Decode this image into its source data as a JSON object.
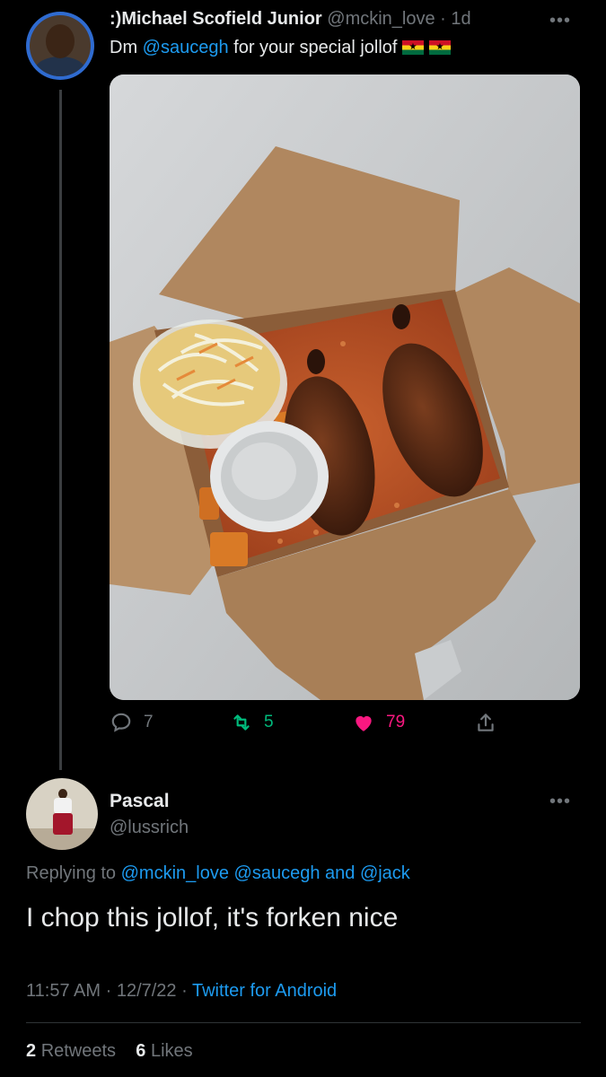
{
  "original_tweet": {
    "author_name": ":)Michael Scofield Junior",
    "handle": "@mckin_love",
    "separator": "·",
    "time": "1d",
    "text_prefix": "Dm ",
    "mention": "@saucegh",
    "text_suffix": " for your special jollof",
    "flag_icon": "ghana-flag-icon",
    "media_icon": "jollof-rice-takeout-photo",
    "reply_count": "7",
    "retweet_count": "5",
    "like_count": "79",
    "colors": {
      "retweet": "#00ba7c",
      "like": "#f91880",
      "link": "#1d9bf0"
    }
  },
  "reply_tweet": {
    "author_name": "Pascal",
    "handle": "@lussrich",
    "replying_label": "Replying to ",
    "replying_mention_1": "@mckin_love",
    "replying_mention_2": "@saucegh",
    "replying_and": " and ",
    "replying_mention_3": "@jack",
    "text": "I chop this jollof, it's forken nice",
    "time": "11:57 AM",
    "date": "12/7/22",
    "separator": "·",
    "client": "Twitter for Android",
    "retweets_count": "2",
    "retweets_label": "Retweets",
    "likes_count": "6",
    "likes_label": "Likes"
  },
  "more_glyph": "•••"
}
